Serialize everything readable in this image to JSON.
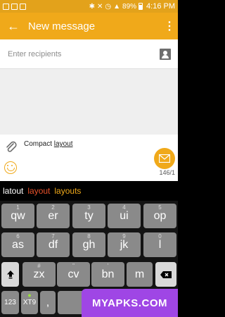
{
  "status": {
    "battery": "89%",
    "time": "4:16 PM"
  },
  "appbar": {
    "title": "New message"
  },
  "recipients": {
    "placeholder": "Enter recipients"
  },
  "compose": {
    "text_plain": "Compact ",
    "text_underlined": "layout",
    "counter": "146/1"
  },
  "suggestions": [
    "latout",
    "layout",
    "layouts"
  ],
  "keyboard": {
    "row1": [
      {
        "main": "qw",
        "hint": "1"
      },
      {
        "main": "er",
        "hint": "2"
      },
      {
        "main": "ty",
        "hint": "3"
      },
      {
        "main": "ui",
        "hint": "4"
      },
      {
        "main": "op",
        "hint": "5"
      }
    ],
    "row2": [
      {
        "main": "as",
        "hint": "6"
      },
      {
        "main": "df",
        "hint": "7"
      },
      {
        "main": "gh",
        "hint": "8"
      },
      {
        "main": "jk",
        "hint": "9"
      },
      {
        "main": "l",
        "hint": "0"
      }
    ],
    "row3": [
      {
        "main": "zx",
        "hint": "#"
      },
      {
        "main": "cv",
        "hint": "\""
      },
      {
        "main": "bn",
        "hint": "'"
      },
      {
        "main": "m",
        "hint": ""
      }
    ],
    "bottom": {
      "symbols": "123",
      "mode": "XT9",
      "comma": ","
    }
  },
  "watermark": "MYAPKS.COM"
}
